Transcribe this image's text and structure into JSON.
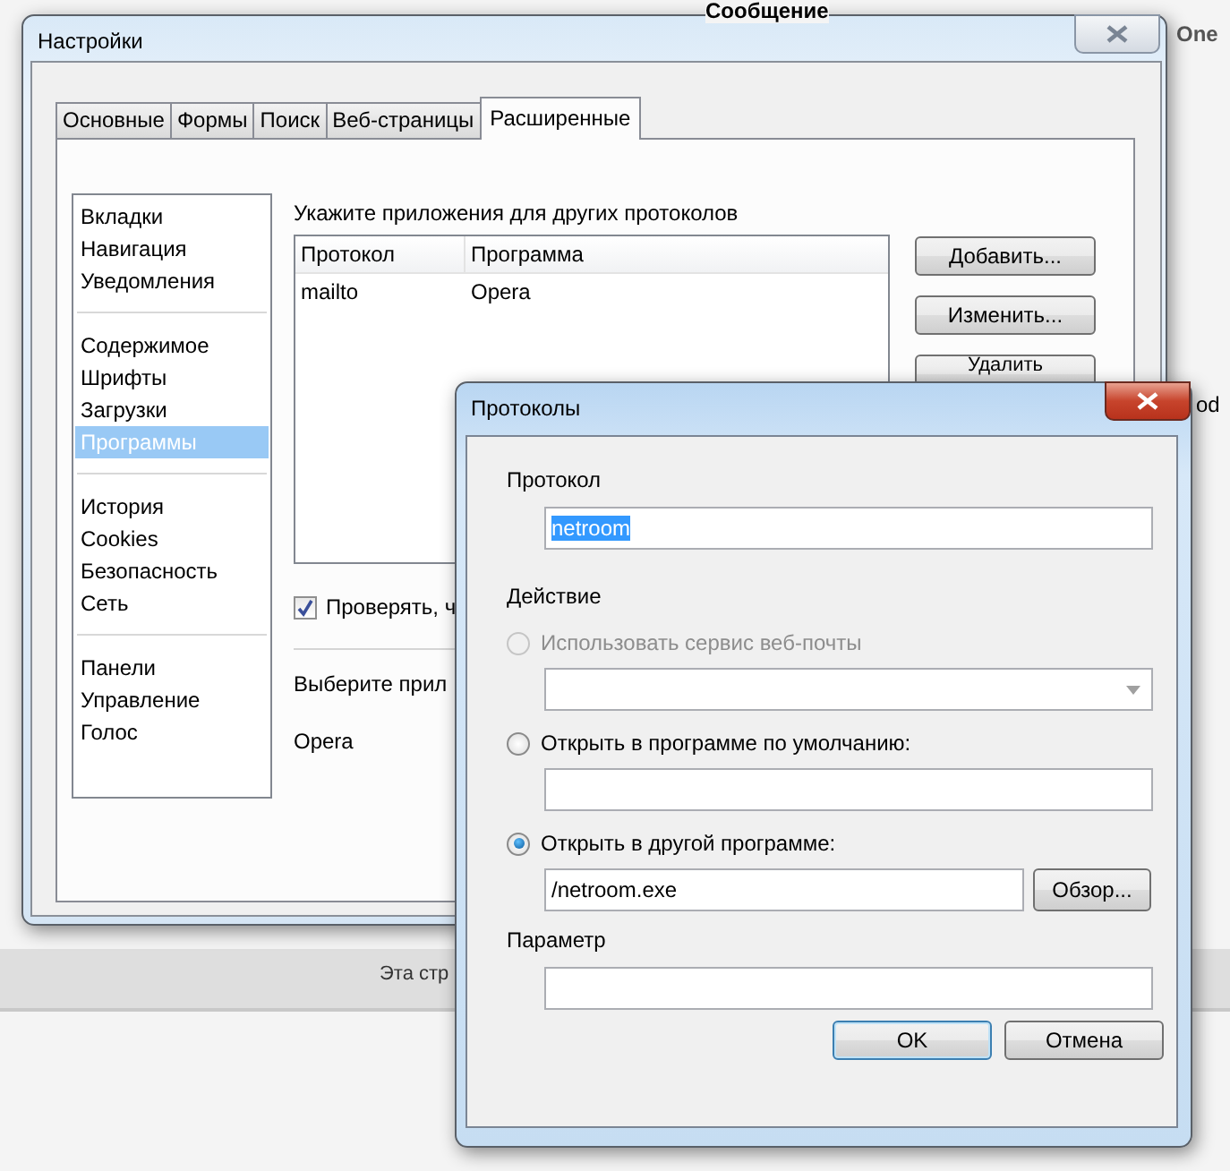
{
  "background": {
    "heading": "Сообщение",
    "link": "One",
    "footer": "Эта стр",
    "side_text": "od"
  },
  "settings_window": {
    "title": "Настройки",
    "tabs": [
      {
        "label": "Основные",
        "selected": false
      },
      {
        "label": "Формы",
        "selected": false
      },
      {
        "label": "Поиск",
        "selected": false
      },
      {
        "label": "Веб-страницы",
        "selected": false
      },
      {
        "label": "Расширенные",
        "selected": true
      }
    ],
    "sidebar": {
      "groups": [
        {
          "items": [
            {
              "label": "Вкладки",
              "selected": false
            },
            {
              "label": "Навигация",
              "selected": false
            },
            {
              "label": "Уведомления",
              "selected": false
            }
          ]
        },
        {
          "items": [
            {
              "label": "Содержимое",
              "selected": false
            },
            {
              "label": "Шрифты",
              "selected": false
            },
            {
              "label": "Загрузки",
              "selected": false
            },
            {
              "label": "Программы",
              "selected": true
            }
          ]
        },
        {
          "items": [
            {
              "label": "История",
              "selected": false
            },
            {
              "label": "Cookies",
              "selected": false
            },
            {
              "label": "Безопасность",
              "selected": false
            },
            {
              "label": "Сеть",
              "selected": false
            }
          ]
        },
        {
          "items": [
            {
              "label": "Панели",
              "selected": false
            },
            {
              "label": "Управление",
              "selected": false
            },
            {
              "label": "Голос",
              "selected": false
            }
          ]
        }
      ]
    },
    "section_label": "Укажите приложения для других протоколов",
    "table": {
      "columns": [
        "Протокол",
        "Программа"
      ],
      "rows": [
        [
          "mailto",
          "Opera"
        ]
      ]
    },
    "buttons": [
      "Добавить...",
      "Изменить...",
      "Удалить"
    ],
    "checkbox": {
      "label": "Проверять, ч",
      "checked": true
    },
    "choose_label": "Выберите прил",
    "choice": "Opera"
  },
  "dialog": {
    "title": "Протоколы",
    "protocol_label": "Протокол",
    "protocol_value": "netroom",
    "action_label": "Действие",
    "options": [
      {
        "kind": "dropdown",
        "label": "Использовать сервис веб-почты",
        "selected": false,
        "disabled": true
      },
      {
        "kind": "field",
        "label": "Открыть в программе по умолчанию:",
        "selected": false,
        "disabled": false
      },
      {
        "kind": "browse",
        "label": "Открыть в другой программе:",
        "selected": true,
        "disabled": false,
        "value": "/netroom.exe",
        "button": "Обзор..."
      }
    ],
    "parameter_label": "Параметр",
    "buttons": [
      "OK",
      "Отмена"
    ]
  }
}
